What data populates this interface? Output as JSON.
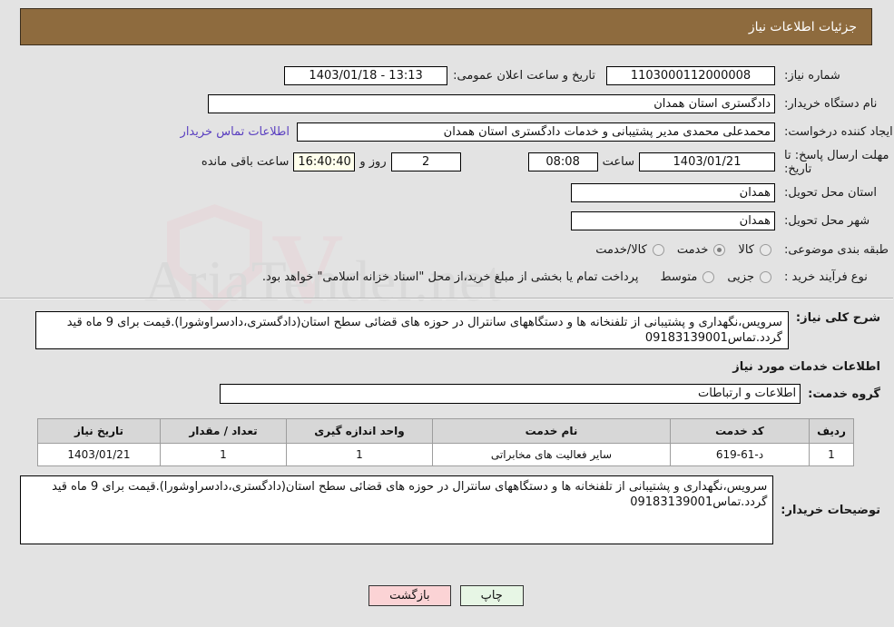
{
  "header": {
    "title": "جزئیات اطلاعات نیاز"
  },
  "colors": {
    "header_bg": "#8e6b3e",
    "page_bg": "#e3e3e3",
    "link": "#5a3fc0",
    "countdown_bg": "#ffffec",
    "print_btn_bg": "#e7f6e5",
    "back_btn_bg": "#fbd3d5"
  },
  "form": {
    "need_number_label": "شماره نیاز:",
    "need_number_value": "1103000112000008",
    "public_announce_label": "تاریخ و ساعت اعلان عمومی:",
    "public_announce_value": "1403/01/18 - 13:13",
    "buyer_org_label": "نام دستگاه خریدار:",
    "buyer_org_value": "دادگستری استان همدان",
    "creator_label": "ایجاد کننده درخواست:",
    "creator_value": "محمدعلی محمدی مدیر پشتیبانی و خدمات دادگستری استان همدان",
    "buyer_contact_link": "اطلاعات تماس خریدار",
    "deadline_label_line1": "مهلت ارسال پاسخ: تا",
    "deadline_label_line2": "تاریخ:",
    "deadline_date": "1403/01/21",
    "deadline_hour_label": "ساعت",
    "deadline_hour_value": "08:08",
    "days_remaining": "2",
    "days_word": "روز و",
    "countdown_value": "16:40:40",
    "countdown_suffix": "ساعت باقی مانده",
    "province_label": "استان محل تحویل:",
    "province_value": "همدان",
    "city_label": "شهر محل تحویل:",
    "city_value": "همدان",
    "category_label": "طبقه بندی موضوعی:",
    "category_options": [
      {
        "label": "کالا",
        "selected": false
      },
      {
        "label": "خدمت",
        "selected": true
      },
      {
        "label": "کالا/خدمت",
        "selected": false
      }
    ],
    "process_label": "نوع فرآیند خرید :",
    "process_options": [
      {
        "label": "جزیی",
        "selected": false
      },
      {
        "label": "متوسط",
        "selected": false
      }
    ],
    "payment_note": "پرداخت تمام یا بخشی از مبلغ خرید،از محل \"اسناد خزانه اسلامی\" خواهد بود."
  },
  "general_description": {
    "label": "شرح کلی نیاز:",
    "text": "سرویس،نگهداری و پشتیبانی از تلفنخانه ها و دستگاههای سانترال در حوزه های قضائی سطح استان(دادگستری،دادسراوشورا).قیمت برای 9 ماه قید گردد.تماس09183139001"
  },
  "services_section": {
    "title": "اطلاعات خدمات مورد نیاز",
    "group_label": "گروه خدمت:",
    "group_value": "اطلاعات و ارتباطات"
  },
  "table": {
    "headers": [
      "ردیف",
      "کد خدمت",
      "نام خدمت",
      "واحد اندازه گیری",
      "تعداد / مقدار",
      "تاریخ نیاز"
    ],
    "rows": [
      {
        "row": "1",
        "code": "د-61-619",
        "name": "سایر فعالیت های مخابراتی",
        "unit": "1",
        "qty": "1",
        "date": "1403/01/21"
      }
    ]
  },
  "buyer_notes": {
    "label": "توضیحات خریدار:",
    "text": "سرویس،نگهداری و پشتیبانی از تلفنخانه ها و دستگاههای سانترال در حوزه های قضائی سطح استان(دادگستری،دادسراوشورا).قیمت برای 9 ماه قید گردد.تماس09183139001"
  },
  "footer": {
    "print_label": "چاپ",
    "back_label": "بازگشت"
  },
  "watermark": {
    "text": "AriaTender.net"
  }
}
